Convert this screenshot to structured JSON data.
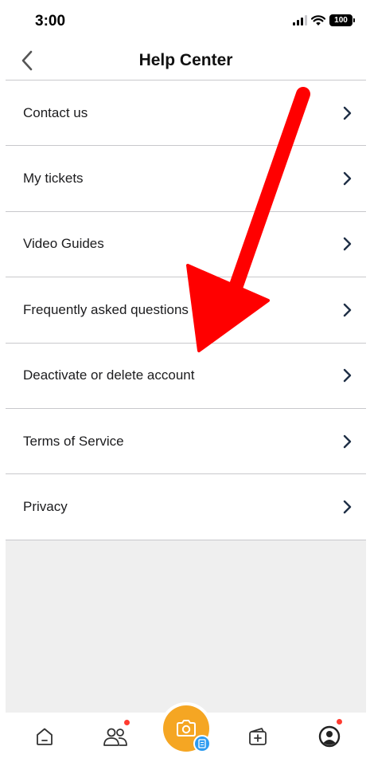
{
  "status_bar": {
    "time": "3:00",
    "battery": "100"
  },
  "header": {
    "title": "Help Center"
  },
  "menu": {
    "items": [
      {
        "label": "Contact us"
      },
      {
        "label": "My tickets"
      },
      {
        "label": "Video Guides"
      },
      {
        "label": "Frequently asked questions"
      },
      {
        "label": "Deactivate or delete account"
      },
      {
        "label": "Terms of Service"
      },
      {
        "label": "Privacy"
      }
    ]
  },
  "tab_bar": {
    "tabs": [
      {
        "icon": "home-icon"
      },
      {
        "icon": "friends-icon",
        "notification": true
      },
      {
        "icon": "camera-icon",
        "badge_icon": "receipt-icon"
      },
      {
        "icon": "add-card-icon"
      },
      {
        "icon": "profile-icon",
        "notification": true
      }
    ]
  },
  "colors": {
    "accent_orange": "#f5a623",
    "badge_blue": "#2d9bf0",
    "notification_red": "#ff3b30",
    "annotation_arrow": "#ff0000"
  }
}
